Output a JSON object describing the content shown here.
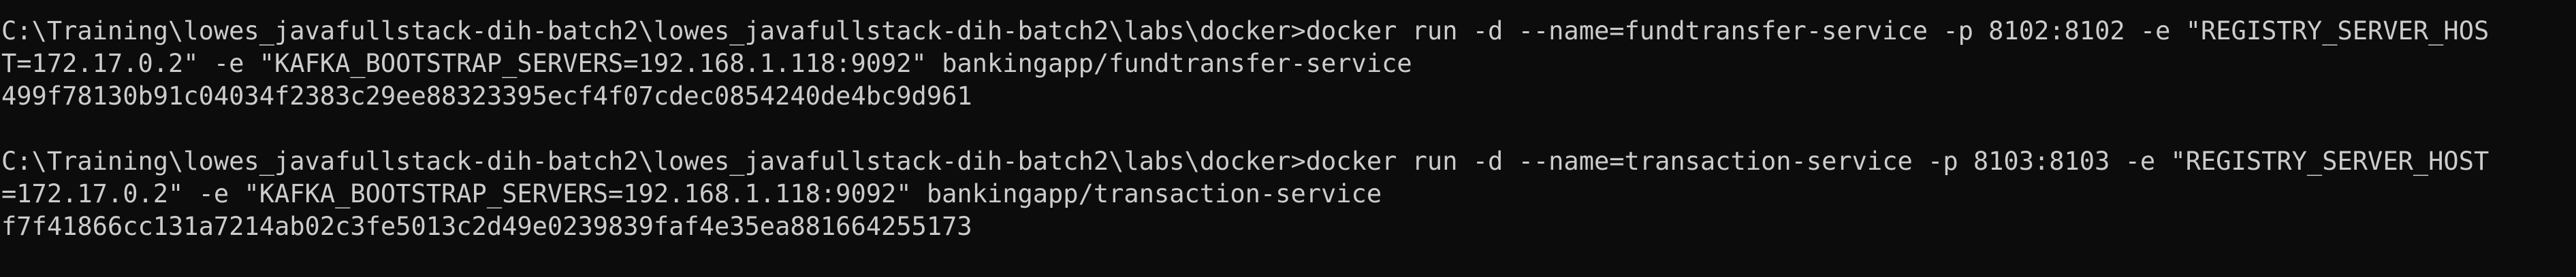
{
  "terminal": {
    "lines": [
      "C:\\Training\\lowes_javafullstack-dih-batch2\\lowes_javafullstack-dih-batch2\\labs\\docker>docker run -d --name=fundtransfer-service -p 8102:8102 -e \"REGISTRY_SERVER_HOS",
      "T=172.17.0.2\" -e \"KAFKA_BOOTSTRAP_SERVERS=192.168.1.118:9092\" bankingapp/fundtransfer-service",
      "499f78130b91c04034f2383c29ee88323395ecf4f07cdec0854240de4bc9d961",
      "",
      "C:\\Training\\lowes_javafullstack-dih-batch2\\lowes_javafullstack-dih-batch2\\labs\\docker>docker run -d --name=transaction-service -p 8103:8103 -e \"REGISTRY_SERVER_HOST",
      "=172.17.0.2\" -e \"KAFKA_BOOTSTRAP_SERVERS=192.168.1.118:9092\" bankingapp/transaction-service",
      "f7f41866cc131a7214ab02c3fe5013c2d49e0239839faf4e35ea881664255173"
    ],
    "colors": {
      "background": "#0c0c0c",
      "foreground": "#cccccc"
    }
  }
}
